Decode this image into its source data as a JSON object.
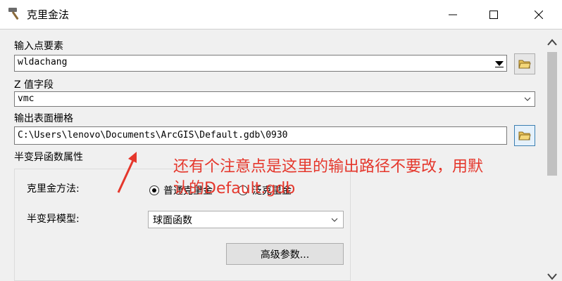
{
  "window": {
    "title": "克里金法",
    "icon": "hammer-icon",
    "controls": {
      "minimize_icon": "minimize-icon",
      "maximize_icon": "maximize-icon",
      "close_icon": "close-icon"
    }
  },
  "form": {
    "input_points": {
      "label": "输入点要素",
      "value": "wldachang"
    },
    "z_field": {
      "label": "Z 值字段",
      "value": "vmc"
    },
    "output_raster": {
      "label": "输出表面栅格",
      "value": "C:\\Users\\lenovo\\Documents\\ArcGIS\\Default.gdb\\0930"
    },
    "semivariogram": {
      "label": "半变异函数属性",
      "method_label": "克里金方法:",
      "method_options": [
        "普通克里金",
        "泛克里金"
      ],
      "method_selected": "普通克里金",
      "model_label": "半变异模型:",
      "model_value": "球面函数",
      "advanced_button": "高级参数..."
    }
  },
  "annotation": {
    "text": "还有个注意点是这里的输出路径不要改，用默认的Default.gdb",
    "color": "#e5372c"
  }
}
